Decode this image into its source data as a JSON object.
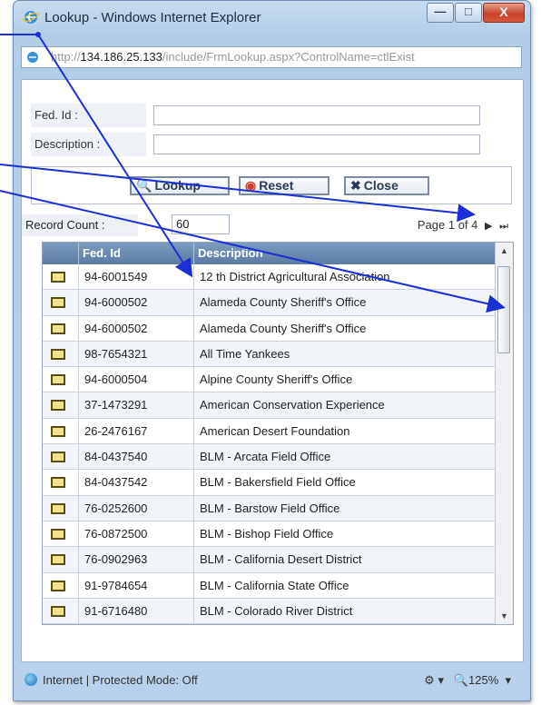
{
  "window": {
    "title": "Lookup - Windows Internet Explorer",
    "min_label": "—",
    "max_label": "□",
    "close_label": "X"
  },
  "address": {
    "prefix": "http://",
    "host": "134.186.25.133",
    "path": "/include/FrmLookup.aspx?ControlName=ctlExist"
  },
  "form": {
    "fed_id_label": "Fed. Id :",
    "fed_id_value": "",
    "description_label": "Description :",
    "description_value": ""
  },
  "buttons": {
    "lookup_label": "Lookup",
    "reset_label": "Reset",
    "close_label": "Close"
  },
  "record_count": {
    "label": "Record Count :",
    "value": "60"
  },
  "pager": {
    "text": "Page 1 of 4",
    "next_icon": "▶",
    "last_icon": "⏭"
  },
  "grid": {
    "columns": [
      "Fed. Id",
      "Description"
    ],
    "rows": [
      {
        "fed_id": "94-6001549",
        "description": "12 th District Agricultural Association"
      },
      {
        "fed_id": "94-6000502",
        "description": "Alameda County Sheriff's Office"
      },
      {
        "fed_id": "94-6000502",
        "description": "Alameda County Sheriff's Office"
      },
      {
        "fed_id": "98-7654321",
        "description": "All Time Yankees"
      },
      {
        "fed_id": "94-6000504",
        "description": "Alpine County Sheriff's Office"
      },
      {
        "fed_id": "37-1473291",
        "description": "American Conservation Experience"
      },
      {
        "fed_id": "26-2476167",
        "description": "American Desert Foundation"
      },
      {
        "fed_id": "84-0437540",
        "description": "BLM - Arcata Field Office"
      },
      {
        "fed_id": "84-0437542",
        "description": "BLM - Bakersfield Field Office"
      },
      {
        "fed_id": "76-0252600",
        "description": "BLM - Barstow Field Office"
      },
      {
        "fed_id": "76-0872500",
        "description": "BLM - Bishop Field Office"
      },
      {
        "fed_id": "76-0902963",
        "description": "BLM - California Desert District"
      },
      {
        "fed_id": "91-9784654",
        "description": "BLM - California State Office"
      },
      {
        "fed_id": "91-6716480",
        "description": "BLM - Colorado River District"
      }
    ]
  },
  "statusbar": {
    "zone_text": "Internet | Protected Mode: Off",
    "zoom_text": "125%"
  },
  "colors": {
    "grid_header": "#5c7ba5",
    "arrow": "#1a2fd6",
    "close_button": "#c8432a"
  }
}
